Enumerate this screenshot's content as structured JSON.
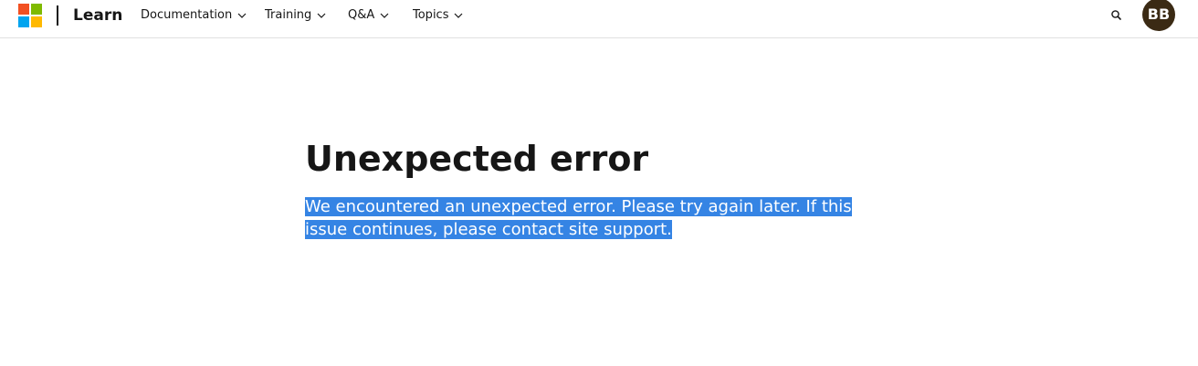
{
  "header": {
    "brand": "Learn",
    "logo_colors": [
      "#f25022",
      "#7fba00",
      "#00a4ef",
      "#ffb900"
    ],
    "nav": [
      {
        "label": "Documentation",
        "icon": "chevron-down-icon"
      },
      {
        "label": "Training",
        "icon": "chevron-down-icon"
      },
      {
        "label": "Q&A",
        "icon": "chevron-down-icon"
      },
      {
        "label": "Topics",
        "icon": "chevron-down-icon"
      }
    ],
    "search_icon": "search-icon",
    "avatar_initials": "BB",
    "avatar_color": "#3b2a14"
  },
  "main": {
    "title": "Unexpected error",
    "message": "We encountered an unexpected error. Please try again later. If this issue continues, please contact site support.",
    "selection_color": "#3584e4"
  }
}
